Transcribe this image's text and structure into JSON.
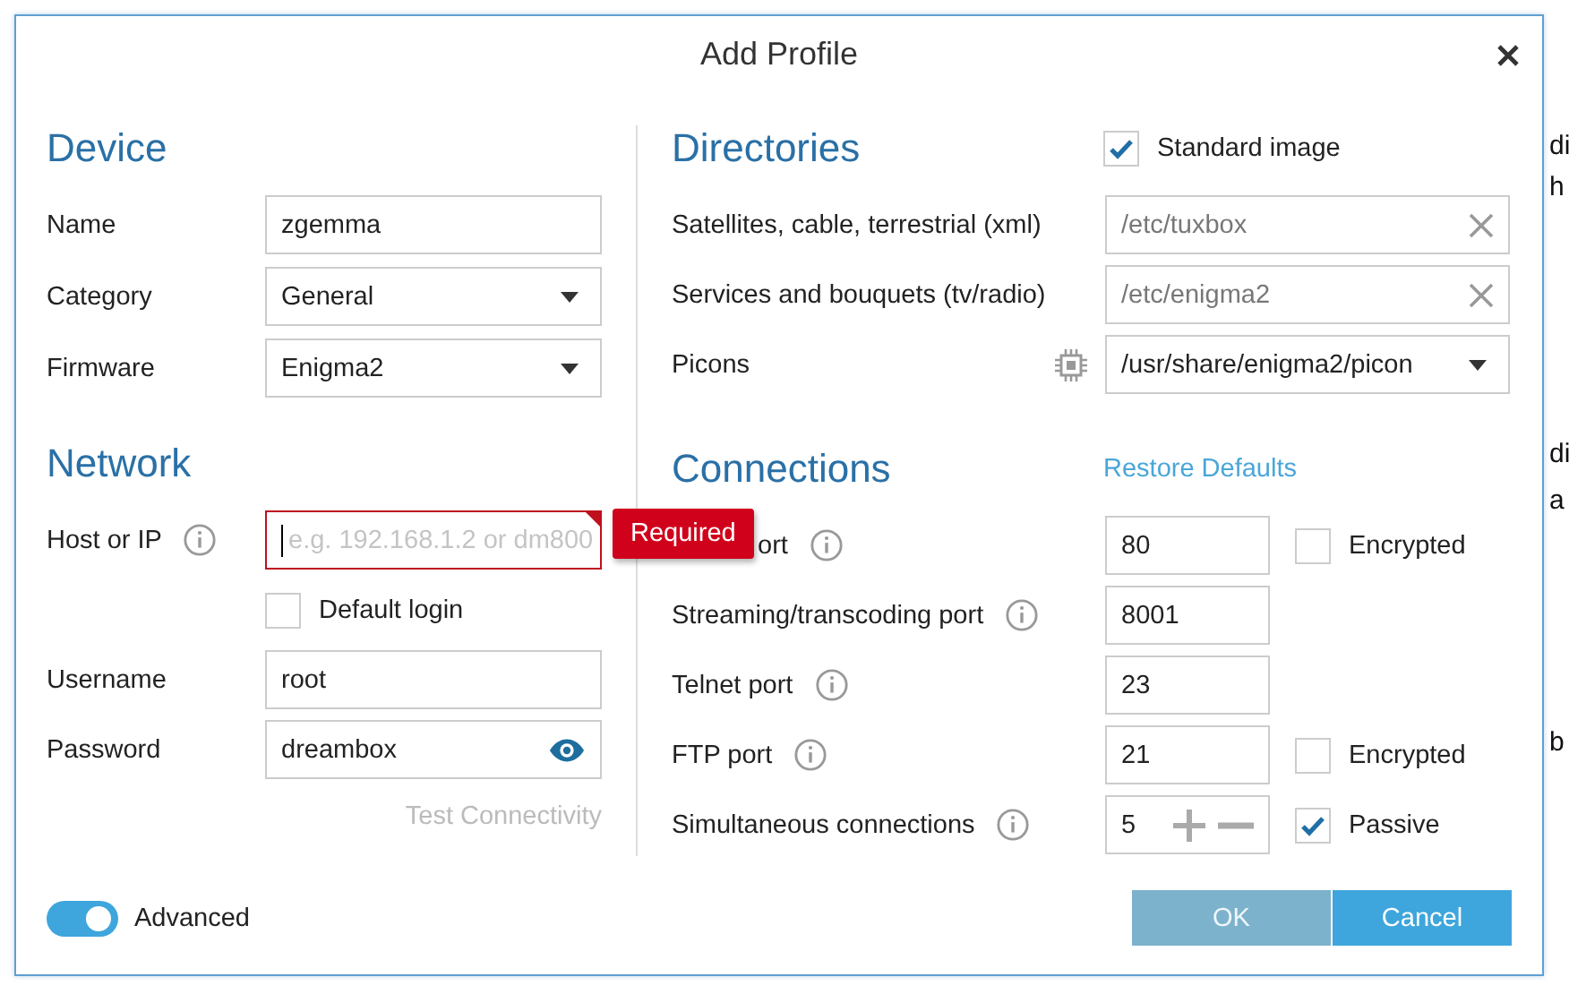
{
  "dialog": {
    "title": "Add Profile"
  },
  "device": {
    "heading": "Device",
    "rows": [
      {
        "kind": "text",
        "label": "Name",
        "value": "zgemma"
      },
      {
        "kind": "select",
        "label": "Category",
        "value": "General"
      },
      {
        "kind": "select",
        "label": "Firmware",
        "value": "Enigma2"
      }
    ]
  },
  "network": {
    "heading": "Network",
    "rows": [
      {
        "kind": "text",
        "label": "Host or IP",
        "info": true,
        "placeholder": "e.g. 192.168.1.2 or dm800",
        "invalid": true,
        "error": "Required"
      },
      {
        "kind": "checkbox",
        "label": "Default login",
        "checked": false
      },
      {
        "kind": "text",
        "label": "Username",
        "value": "root"
      },
      {
        "kind": "password",
        "label": "Password",
        "value": "dreambox"
      }
    ],
    "test_link": "Test Connectivity"
  },
  "directories": {
    "heading": "Directories",
    "standard_image": {
      "label": "Standard image",
      "checked": true
    },
    "rows": [
      {
        "kind": "path",
        "label": "Satellites, cable, terrestrial (xml)",
        "value": "/etc/tuxbox",
        "disabled": true
      },
      {
        "kind": "path",
        "label": "Services and bouquets (tv/radio)",
        "value": "/etc/enigma2",
        "disabled": true
      },
      {
        "kind": "select",
        "label": "Picons",
        "value": "/usr/share/enigma2/picon",
        "chip": true
      }
    ]
  },
  "connections": {
    "heading": "Connections",
    "restore_link": "Restore Defaults",
    "rows": [
      {
        "kind": "port",
        "label": "ort",
        "value": "80",
        "option": {
          "label": "Encrypted",
          "checked": false
        }
      },
      {
        "kind": "port",
        "label": "Streaming/transcoding port",
        "value": "8001"
      },
      {
        "kind": "port",
        "label": "Telnet port",
        "value": "23"
      },
      {
        "kind": "port",
        "label": "FTP port",
        "value": "21",
        "option": {
          "label": "Encrypted",
          "checked": false
        }
      },
      {
        "kind": "stepper",
        "label": "Simultaneous connections",
        "value": "5",
        "option": {
          "label": "Passive",
          "checked": true
        }
      }
    ]
  },
  "footer": {
    "advanced": {
      "label": "Advanced",
      "on": true
    },
    "buttons": [
      {
        "label": "OK",
        "disabled": true
      },
      {
        "label": "Cancel",
        "disabled": false
      }
    ]
  },
  "background_fragments": [
    "di",
    "h",
    "di",
    "a",
    "b"
  ]
}
